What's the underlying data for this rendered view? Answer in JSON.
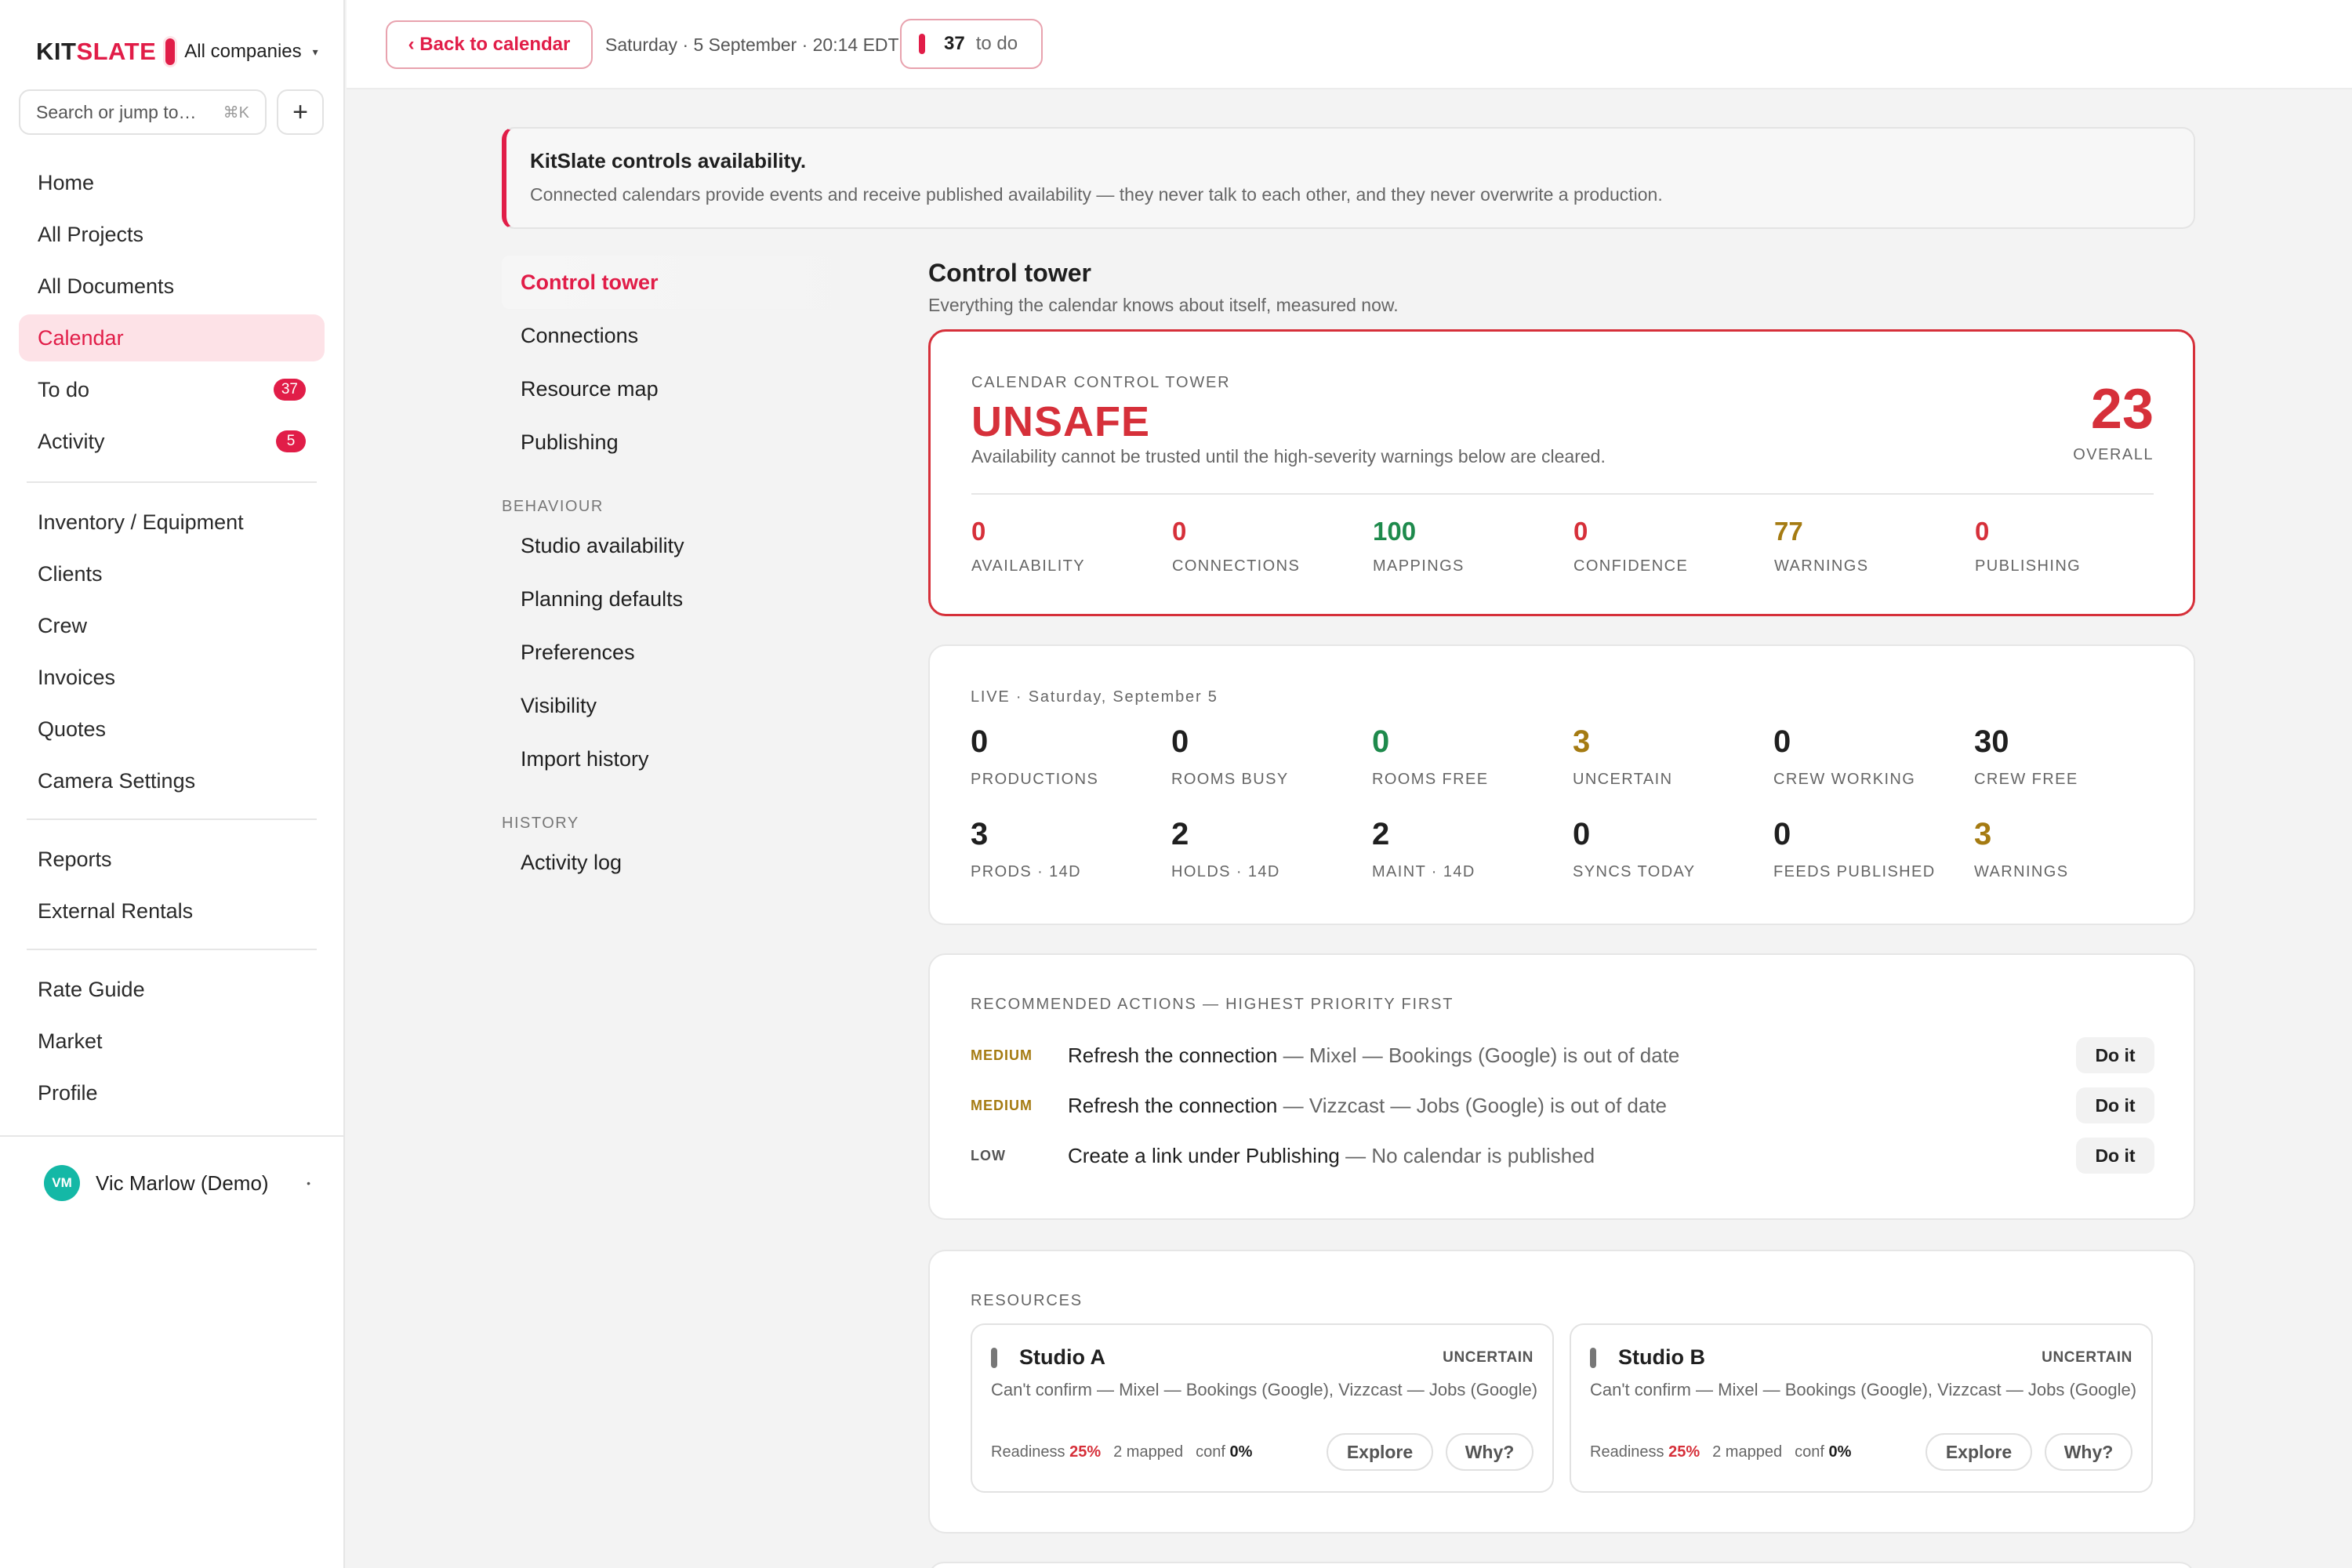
{
  "brand": {
    "name_a": "KIT",
    "name_b": "SLATE",
    "company": "All companies"
  },
  "search": {
    "placeholder": "Search or jump to…",
    "shortcut": "⌘K"
  },
  "sidebar": {
    "group1": [
      {
        "label": "Home"
      },
      {
        "label": "All Projects"
      },
      {
        "label": "All Documents"
      },
      {
        "label": "Calendar",
        "active": true
      },
      {
        "label": "To do",
        "badge": "37"
      },
      {
        "label": "Activity",
        "badge": "5"
      }
    ],
    "group2": [
      {
        "label": "Inventory / Equipment"
      },
      {
        "label": "Clients"
      },
      {
        "label": "Crew"
      },
      {
        "label": "Invoices"
      },
      {
        "label": "Quotes"
      },
      {
        "label": "Camera Settings"
      }
    ],
    "group3": [
      {
        "label": "Reports"
      },
      {
        "label": "External Rentals"
      }
    ],
    "group4": [
      {
        "label": "Rate Guide"
      },
      {
        "label": "Market"
      },
      {
        "label": "Profile"
      }
    ]
  },
  "user": {
    "initials": "VM",
    "name": "Vic Marlow (Demo)"
  },
  "topbar": {
    "back_label": "‹ Back to calendar",
    "datetime": "Saturday · 5 September · 20:14 EDT",
    "todo_count": "37",
    "todo_label": "to do"
  },
  "banner": {
    "title": "KitSlate controls availability.",
    "text": "Connected calendars provide events and receive published availability — they never talk to each other, and they never overwrite a production."
  },
  "subnav": {
    "top": [
      "Control tower",
      "Connections",
      "Resource map",
      "Publishing"
    ],
    "behaviour_heading": "BEHAVIOUR",
    "behaviour": [
      "Studio availability",
      "Planning defaults",
      "Preferences",
      "Visibility",
      "Import history"
    ],
    "history_heading": "HISTORY",
    "history": [
      "Activity log"
    ]
  },
  "main": {
    "title": "Control tower",
    "subtitle": "Everything the calendar knows about itself, measured now."
  },
  "tower": {
    "eyebrow": "CALENDAR CONTROL TOWER",
    "status": "UNSAFE",
    "description": "Availability cannot be trusted until the high-severity warnings below are cleared.",
    "score": "23",
    "score_label": "OVERALL",
    "metrics": [
      {
        "value": "0",
        "label": "AVAILABILITY",
        "tone": "red"
      },
      {
        "value": "0",
        "label": "CONNECTIONS",
        "tone": "red"
      },
      {
        "value": "100",
        "label": "MAPPINGS",
        "tone": "green"
      },
      {
        "value": "0",
        "label": "CONFIDENCE",
        "tone": "red"
      },
      {
        "value": "77",
        "label": "WARNINGS",
        "tone": "amber"
      },
      {
        "value": "0",
        "label": "PUBLISHING",
        "tone": "red"
      }
    ],
    "colors": {
      "unsafe": "#d6303a",
      "good": "#1e8a4c",
      "warn": "#a57b12"
    }
  },
  "live": {
    "eyebrow": "LIVE · Saturday, September 5",
    "row1": [
      {
        "value": "0",
        "label": "PRODUCTIONS",
        "tone": "dark"
      },
      {
        "value": "0",
        "label": "ROOMS BUSY",
        "tone": "dark"
      },
      {
        "value": "0",
        "label": "ROOMS FREE",
        "tone": "green"
      },
      {
        "value": "3",
        "label": "UNCERTAIN",
        "tone": "amber"
      },
      {
        "value": "0",
        "label": "CREW WORKING",
        "tone": "dark"
      },
      {
        "value": "30",
        "label": "CREW FREE",
        "tone": "dark"
      }
    ],
    "row2": [
      {
        "value": "3",
        "label": "PRODS · 14D",
        "tone": "dark"
      },
      {
        "value": "2",
        "label": "HOLDS · 14D",
        "tone": "dark"
      },
      {
        "value": "2",
        "label": "MAINT · 14D",
        "tone": "dark"
      },
      {
        "value": "0",
        "label": "SYNCS TODAY",
        "tone": "dark"
      },
      {
        "value": "0",
        "label": "FEEDS PUBLISHED",
        "tone": "dark"
      },
      {
        "value": "3",
        "label": "WARNINGS",
        "tone": "amber"
      }
    ]
  },
  "actions": {
    "eyebrow": "RECOMMENDED ACTIONS — HIGHEST PRIORITY FIRST",
    "items": [
      {
        "priority": "MEDIUM",
        "level": "medium",
        "title": "Refresh the connection",
        "detail": " — Mixel — Bookings (Google) is out of date",
        "button": "Do it"
      },
      {
        "priority": "MEDIUM",
        "level": "medium",
        "title": "Refresh the connection",
        "detail": " — Vizzcast — Jobs (Google) is out of date",
        "button": "Do it"
      },
      {
        "priority": "LOW",
        "level": "low",
        "title": "Create a link under Publishing",
        "detail": " — No calendar is published",
        "button": "Do it"
      }
    ]
  },
  "resources": {
    "eyebrow": "RESOURCES",
    "items": [
      {
        "name": "Studio A",
        "status": "UNCERTAIN",
        "desc": "Can't confirm — Mixel — Bookings (Google), Vizzcast — Jobs (Google)",
        "readiness_label": "Readiness",
        "readiness": "25%",
        "mapped": "2 mapped",
        "conf_label": "conf",
        "conf": "0%",
        "explore": "Explore",
        "why": "Why?"
      },
      {
        "name": "Studio B",
        "status": "UNCERTAIN",
        "desc": "Can't confirm — Mixel — Bookings (Google), Vizzcast — Jobs (Google)",
        "readiness_label": "Readiness",
        "readiness": "25%",
        "mapped": "2 mapped",
        "conf_label": "conf",
        "conf": "0%",
        "explore": "Explore",
        "why": "Why?"
      }
    ]
  }
}
